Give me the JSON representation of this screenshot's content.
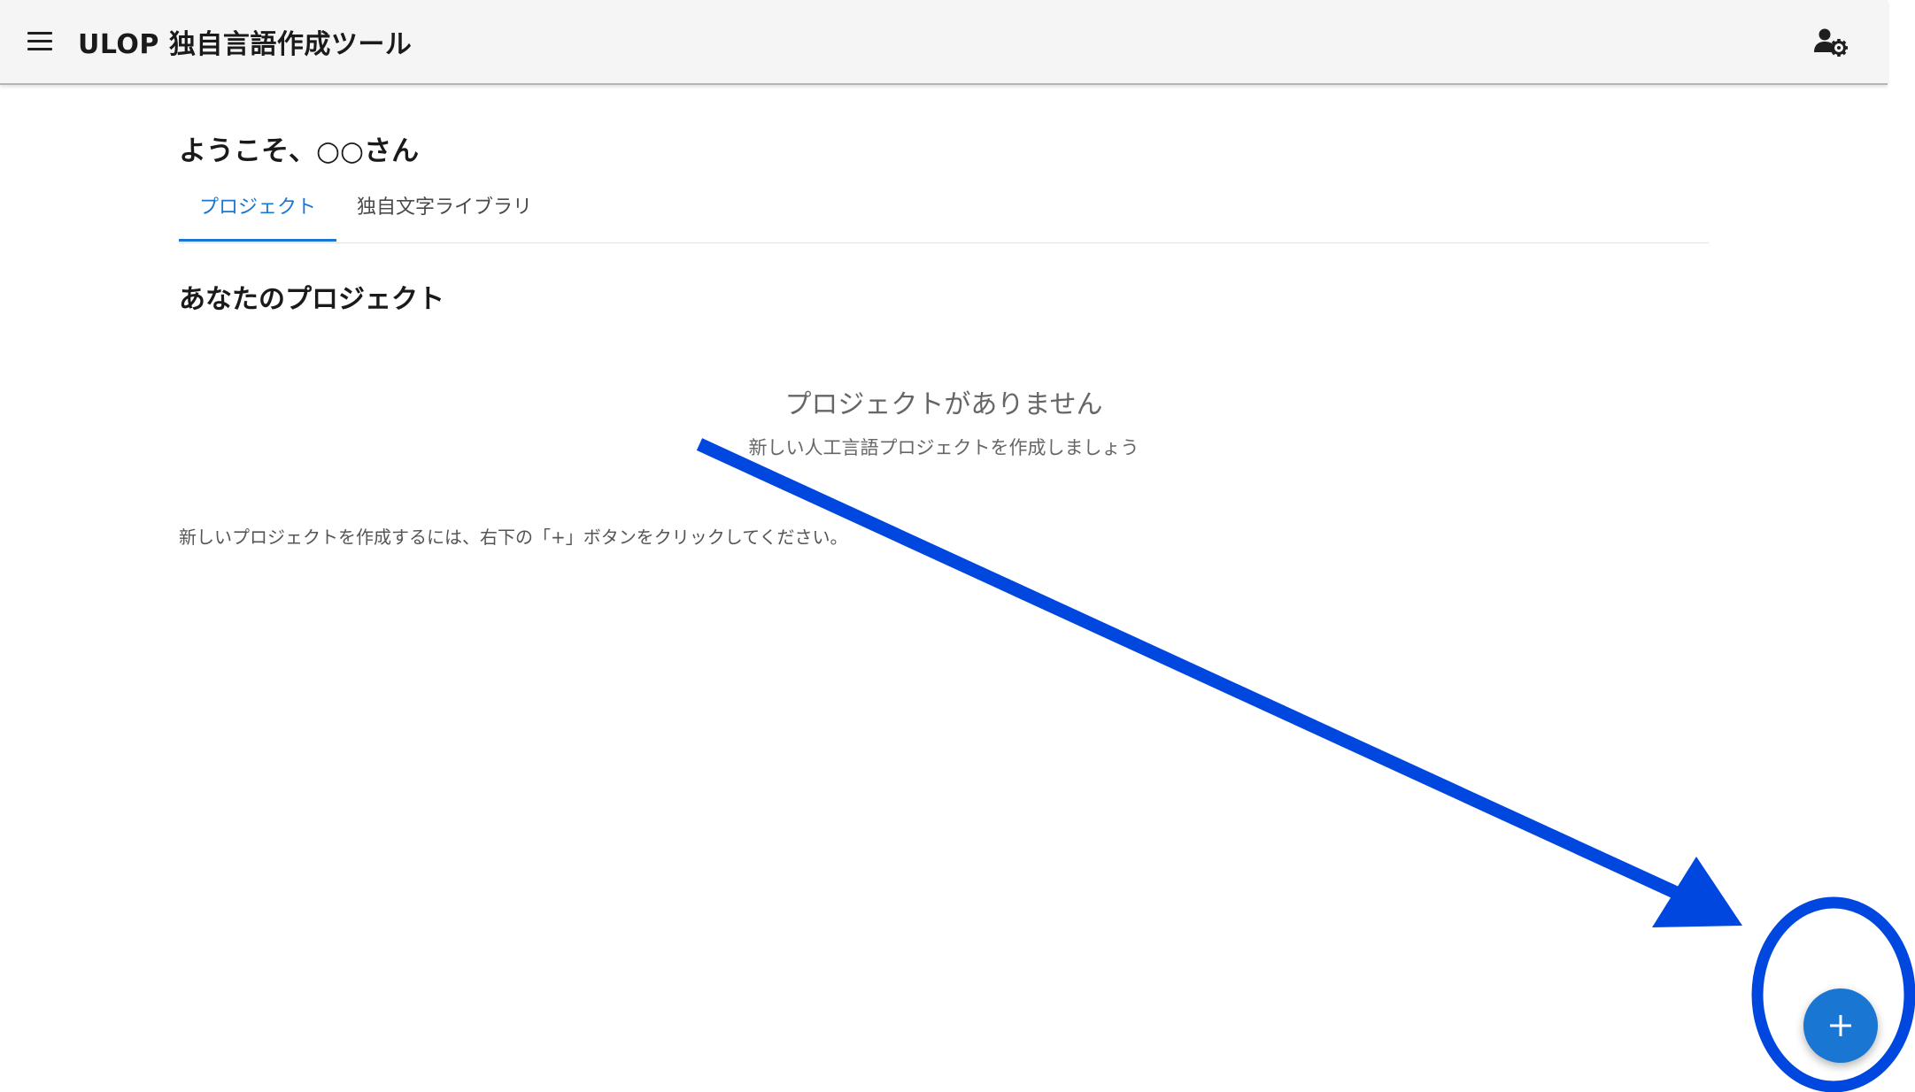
{
  "appbar": {
    "title": "ULOP 独自言語作成ツール",
    "menu_icon": "menu-icon",
    "account_icon": "account-settings-icon"
  },
  "main": {
    "welcome": "ようこそ、○○さん",
    "tabs": [
      {
        "label": "プロジェクト",
        "active": true
      },
      {
        "label": "独自文字ライブラリ",
        "active": false
      }
    ],
    "section_title": "あなたのプロジェクト",
    "empty_state": {
      "title": "プロジェクトがありません",
      "subtitle": "新しい人工言語プロジェクトを作成しましょう"
    },
    "hint": "新しいプロジェクトを作成するには、右下の「+」ボタンをクリックしてください。"
  },
  "fab": {
    "icon": "plus-icon"
  },
  "annotation": {
    "color": "#0047e0"
  },
  "colors": {
    "primary": "#1976d2",
    "appbar_bg": "#f5f5f5",
    "annotation": "#0047e0"
  }
}
